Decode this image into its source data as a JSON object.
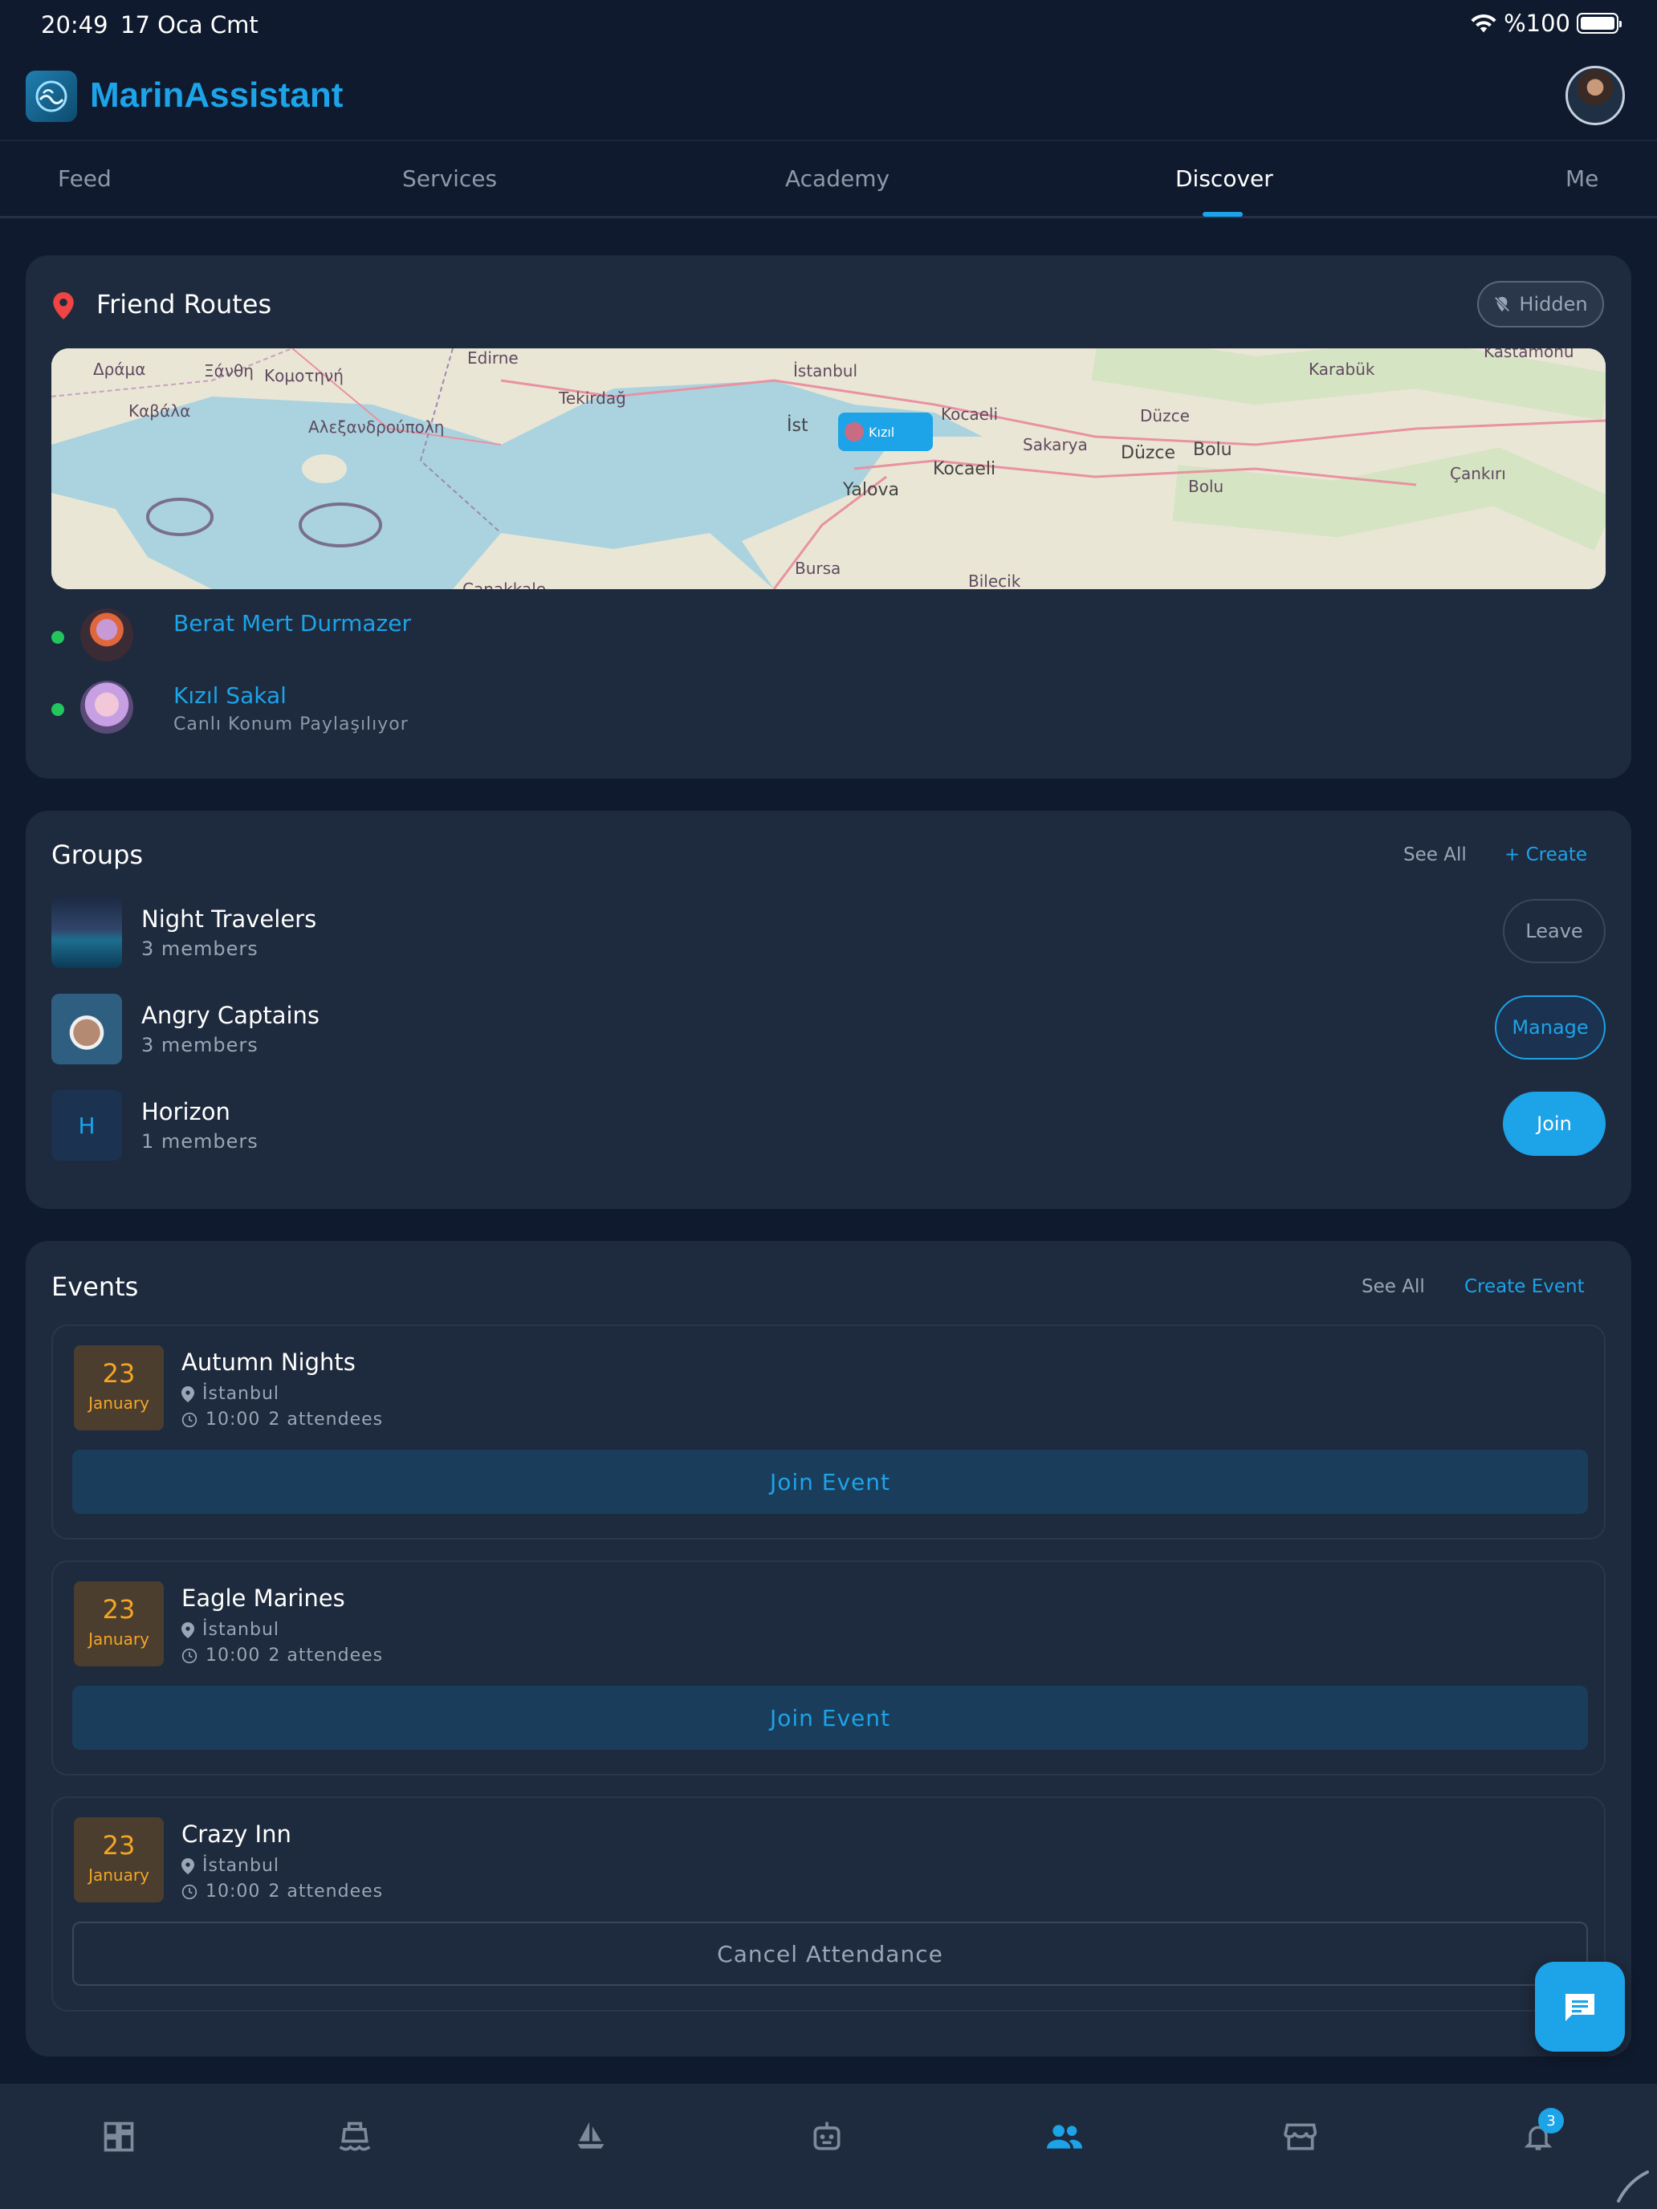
{
  "status": {
    "time": "20:49",
    "date": "17 Oca Cmt",
    "battery": "%100"
  },
  "app": {
    "title": "MarinAssistant"
  },
  "tabs": [
    {
      "label": "Feed"
    },
    {
      "label": "Services"
    },
    {
      "label": "Academy"
    },
    {
      "label": "Discover"
    },
    {
      "label": "Me"
    }
  ],
  "friend_routes": {
    "title": "Friend Routes",
    "hidden_label": "Hidden",
    "map": {
      "labels": [
        "Δράμα",
        "Ξάνθη",
        "Κομοτηνή",
        "Καβάλα",
        "Αλεξανδρούπολη",
        "Edirne",
        "Tekirdağ",
        "İstanbul",
        "İst",
        "Kocaeli",
        "Kocaeli",
        "Yalova",
        "Düzce",
        "Düzce",
        "Sakarya",
        "Bolu",
        "Bolu",
        "Karabük",
        "Kastamonu",
        "Çankırı",
        "Bursa",
        "Bilecik",
        "Çanakkale"
      ],
      "marker_label": "Kızıl"
    },
    "friends": [
      {
        "name": "Berat Mert Durmazer",
        "subtitle": ""
      },
      {
        "name": "Kızıl Sakal",
        "subtitle": "Canlı Konum Paylaşılıyor"
      }
    ]
  },
  "groups": {
    "title": "Groups",
    "see_all": "See All",
    "create": "+ Create",
    "items": [
      {
        "name": "Night Travelers",
        "members": "3 members",
        "action": "Leave"
      },
      {
        "name": "Angry Captains",
        "members": "3 members",
        "action": "Manage"
      },
      {
        "name": "Horizon",
        "members": "1 members",
        "action": "Join",
        "initial": "H"
      }
    ]
  },
  "events": {
    "title": "Events",
    "see_all": "See All",
    "create": "Create Event",
    "items": [
      {
        "day": "23",
        "month": "January",
        "name": "Autumn Nights",
        "location": "İstanbul",
        "time": "10:00",
        "attendees": "2 attendees",
        "action": "Join Event"
      },
      {
        "day": "23",
        "month": "January",
        "name": "Eagle Marines",
        "location": "İstanbul",
        "time": "10:00",
        "attendees": "2 attendees",
        "action": "Join Event"
      },
      {
        "day": "23",
        "month": "January",
        "name": "Crazy Inn",
        "location": "İstanbul",
        "time": "10:00",
        "attendees": "2 attendees",
        "action": "Cancel Attendance"
      }
    ]
  },
  "bottom_nav": {
    "items": [
      {
        "icon": "dashboard-icon"
      },
      {
        "icon": "ship-icon"
      },
      {
        "icon": "sailboat-icon"
      },
      {
        "icon": "robot-icon"
      },
      {
        "icon": "people-icon",
        "active": true
      },
      {
        "icon": "store-icon"
      },
      {
        "icon": "bell-icon",
        "badge": "3"
      }
    ]
  },
  "colors": {
    "accent": "#1ca3e8",
    "background": "#0f1a2e",
    "card": "#1e2a3d",
    "date_accent": "#f5a524",
    "online": "#22c55e"
  }
}
